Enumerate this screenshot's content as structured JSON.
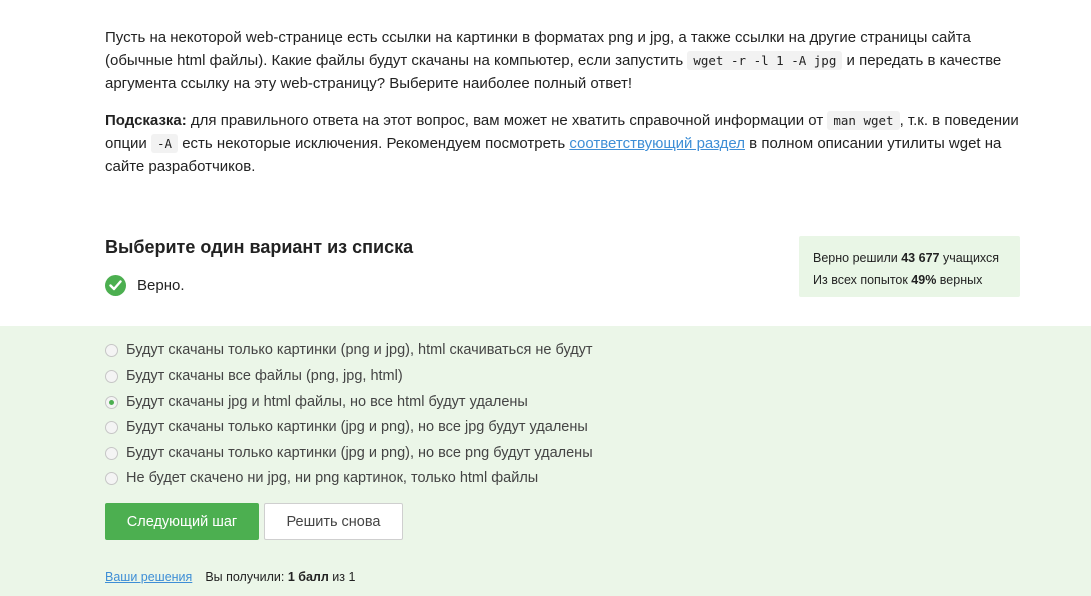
{
  "question": {
    "p1_a": "Пусть на некоторой web-странице есть ссылки на картинки в форматах png и jpg, а также ссылки на другие страницы сайта (обычные html файлы). Какие файлы будут скачаны на компьютер, если запустить ",
    "p1_code": "wget -r -l 1 -A jpg",
    "p1_b": " и передать в качестве аргумента ссылку на эту web-страницу? Выберите наиболее полный ответ!",
    "hint_label": "Подсказка:",
    "hint_a": " для правильного ответа на этот вопрос, вам может не хватить справочной информации от ",
    "hint_code1": "man wget",
    "hint_b": ", т.к. в поведении опции ",
    "hint_code2": "-A",
    "hint_c": " есть некоторые исключения. Рекомендуем посмотреть ",
    "hint_link": "соответствующий раздел",
    "hint_d": " в полном описании утилиты wget на сайте разработчиков."
  },
  "choose_title": "Выберите один вариант из списка",
  "verdict": "Верно.",
  "stats": {
    "solved_prefix": "Верно решили ",
    "solved_count": "43 677",
    "solved_suffix": " учащихся",
    "attempts_prefix": "Из всех попыток ",
    "attempts_percent": "49%",
    "attempts_suffix": " верных"
  },
  "options": [
    {
      "label": "Будут скачаны только картинки (png и jpg), html скачиваться не будут",
      "checked": false
    },
    {
      "label": "Будут скачаны все файлы (png, jpg, html)",
      "checked": false
    },
    {
      "label": "Будут скачаны jpg и html файлы, но все html будут удалены",
      "checked": true
    },
    {
      "label": "Будут скачаны только картинки (jpg и png), но все jpg будут удалены",
      "checked": false
    },
    {
      "label": "Будут скачаны только картинки (jpg и png), но все png будут удалены",
      "checked": false
    },
    {
      "label": "Не будет скачено ни jpg, ни png картинок, только html файлы",
      "checked": false
    }
  ],
  "buttons": {
    "next": "Следующий шаг",
    "retry": "Решить снова"
  },
  "footer": {
    "solutions_link": "Ваши решения",
    "score_prefix": "Вы получили: ",
    "score_value": "1 балл",
    "score_suffix": " из 1"
  },
  "colors": {
    "accent": "#4caf50",
    "link": "#3e8ed6",
    "answers_bg": "#ebf6e8",
    "stats_bg": "#e9f6e6"
  }
}
